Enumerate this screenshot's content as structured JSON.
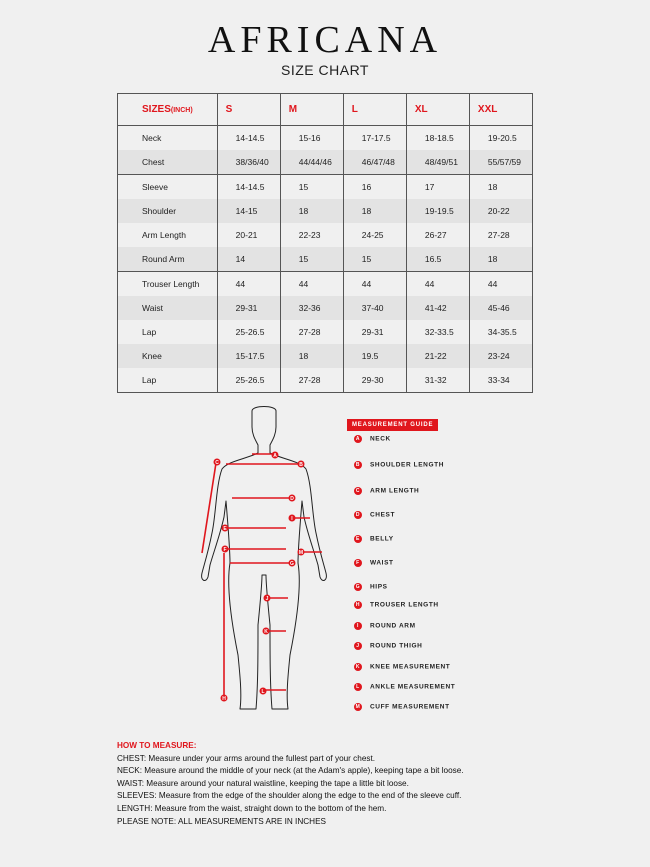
{
  "brand": "AFRICANA",
  "subtitle": "SIZE CHART",
  "table": {
    "header": {
      "label": "SIZES",
      "unit": "(INCH)",
      "sizes": [
        "S",
        "M",
        "L",
        "XL",
        "XXL"
      ]
    },
    "rows": [
      {
        "label": "Neck",
        "values": [
          "14-14.5",
          "15-16",
          "17-17.5",
          "18-18.5",
          "19-20.5"
        ]
      },
      {
        "label": "Chest",
        "values": [
          "38/36/40",
          "44/44/46",
          "46/47/48",
          "48/49/51",
          "55/57/59"
        ]
      },
      {
        "label": "Sleeve",
        "values": [
          "14-14.5",
          "15",
          "16",
          "17",
          "18"
        ]
      },
      {
        "label": "Shoulder",
        "values": [
          "14-15",
          "18",
          "18",
          "19-19.5",
          "20-22"
        ]
      },
      {
        "label": "Arm Length",
        "values": [
          "20-21",
          "22-23",
          "24-25",
          "26-27",
          "27-28"
        ]
      },
      {
        "label": "Round Arm",
        "values": [
          "14",
          "15",
          "15",
          "16.5",
          "18"
        ]
      },
      {
        "label": "Trouser Length",
        "values": [
          "44",
          "44",
          "44",
          "44",
          "44"
        ]
      },
      {
        "label": "Waist",
        "values": [
          "29-31",
          "32-36",
          "37-40",
          "41-42",
          "45-46"
        ]
      },
      {
        "label": "Lap",
        "values": [
          "25-26.5",
          "27-28",
          "29-31",
          "32-33.5",
          "34-35.5"
        ]
      },
      {
        "label": "Knee",
        "values": [
          "15-17.5",
          "18",
          "19.5",
          "21-22",
          "23-24"
        ]
      },
      {
        "label": "Lap",
        "values": [
          "25-26.5",
          "27-28",
          "29-30",
          "31-32",
          "33-34"
        ]
      }
    ]
  },
  "guide": {
    "title": "MEASUREMENT GUIDE",
    "items": [
      {
        "key": "A",
        "label": "NECK"
      },
      {
        "key": "B",
        "label": "SHOULDER LENGTH"
      },
      {
        "key": "C",
        "label": "ARM LENGTH"
      },
      {
        "key": "D",
        "label": "CHEST"
      },
      {
        "key": "E",
        "label": "BELLY"
      },
      {
        "key": "F",
        "label": "WAIST"
      },
      {
        "key": "G",
        "label": "HIPS"
      },
      {
        "key": "H",
        "label": "TROUSER LENGTH"
      },
      {
        "key": "I",
        "label": "ROUND ARM"
      },
      {
        "key": "J",
        "label": "ROUND THIGH"
      },
      {
        "key": "K",
        "label": "KNEE MEASUREMENT"
      },
      {
        "key": "L",
        "label": "ANKLE MEASUREMENT"
      },
      {
        "key": "M",
        "label": "CUFF MEASUREMENT"
      }
    ]
  },
  "howto": {
    "title": "HOW TO MEASURE:",
    "lines": [
      "CHEST: Measure under your arms around the fullest part of your chest.",
      "NECK: Measure around the middle of your neck (at the Adam's apple), keeping tape a bit loose.",
      "WAIST: Measure around your natural waistline, keeping the tape a little bit loose.",
      "SLEEVES: Measure from the edge of the shoulder along the edge to the end of the sleeve cuff.",
      "LENGTH: Measure from the waist, straight down to the bottom of the hem.",
      "PLEASE NOTE: ALL MEASUREMENTS ARE IN INCHES"
    ]
  },
  "colors": {
    "accent": "#e0161d",
    "background": "#f0f0f0",
    "shade": "#e3e3e3"
  }
}
